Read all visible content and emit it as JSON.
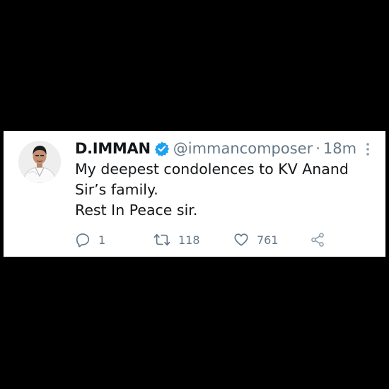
{
  "tweet": {
    "display_name": "D.IMMAN",
    "handle": "@immancomposer",
    "separator": "·",
    "time": "18m",
    "text_lines": [
      "My deepest condolences to KV Anand",
      "Sir’s family.",
      "Rest In Peace sir."
    ]
  },
  "actions": {
    "reply_count": "1",
    "retweet_count": "118",
    "like_count": "761"
  },
  "colors": {
    "background": "#000000",
    "card": "#ffffff",
    "text": "#14171a",
    "secondary": "#657786",
    "verified": "#1da1f2"
  },
  "icons": {
    "verified": "verified-badge-icon",
    "more": "more-vertical-icon",
    "reply": "reply-icon",
    "retweet": "retweet-icon",
    "like": "heart-icon",
    "share": "share-icon"
  }
}
